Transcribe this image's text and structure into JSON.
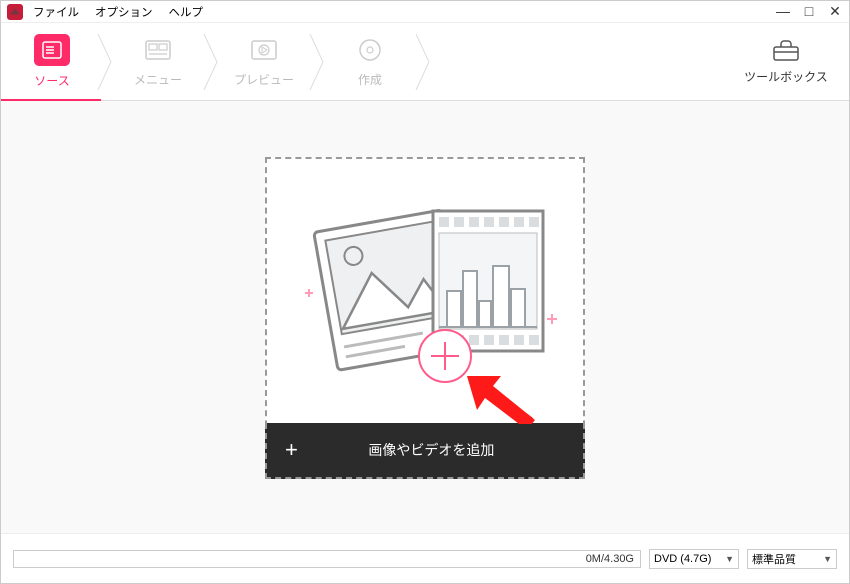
{
  "menu": {
    "file": "ファイル",
    "options": "オプション",
    "help": "ヘルプ"
  },
  "window": {
    "min": "—",
    "max": "□",
    "close": "✕"
  },
  "steps": {
    "source": "ソース",
    "menu": "メニュー",
    "preview": "プレビュー",
    "create": "作成"
  },
  "toolbox": {
    "label": "ツールボックス"
  },
  "drop": {
    "add_label": "画像やビデオを追加"
  },
  "bottom": {
    "progress_text": "0M/4.30G",
    "dvd_select": "DVD (4.7G)",
    "quality_select": "標準品質"
  }
}
